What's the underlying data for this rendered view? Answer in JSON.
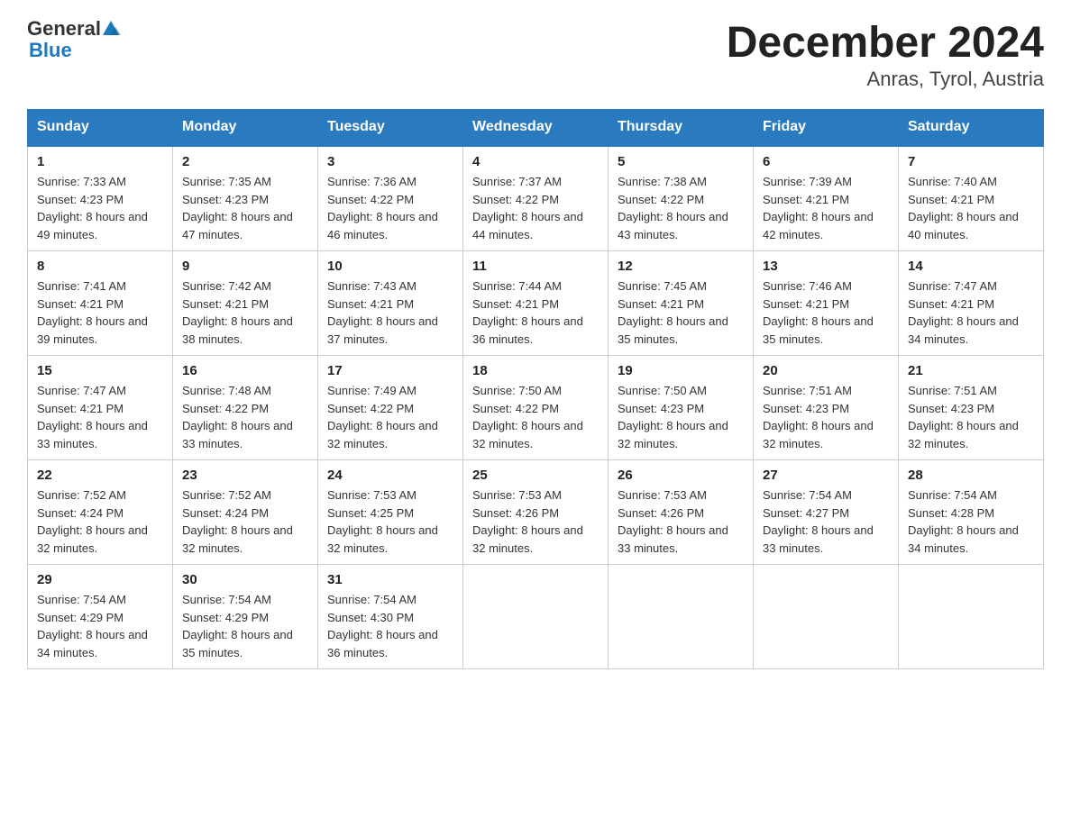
{
  "header": {
    "logo_general": "General",
    "logo_blue": "Blue",
    "title": "December 2024",
    "subtitle": "Anras, Tyrol, Austria"
  },
  "weekdays": [
    "Sunday",
    "Monday",
    "Tuesday",
    "Wednesday",
    "Thursday",
    "Friday",
    "Saturday"
  ],
  "weeks": [
    [
      {
        "day": "1",
        "sunrise": "7:33 AM",
        "sunset": "4:23 PM",
        "daylight": "8 hours and 49 minutes."
      },
      {
        "day": "2",
        "sunrise": "7:35 AM",
        "sunset": "4:23 PM",
        "daylight": "8 hours and 47 minutes."
      },
      {
        "day": "3",
        "sunrise": "7:36 AM",
        "sunset": "4:22 PM",
        "daylight": "8 hours and 46 minutes."
      },
      {
        "day": "4",
        "sunrise": "7:37 AM",
        "sunset": "4:22 PM",
        "daylight": "8 hours and 44 minutes."
      },
      {
        "day": "5",
        "sunrise": "7:38 AM",
        "sunset": "4:22 PM",
        "daylight": "8 hours and 43 minutes."
      },
      {
        "day": "6",
        "sunrise": "7:39 AM",
        "sunset": "4:21 PM",
        "daylight": "8 hours and 42 minutes."
      },
      {
        "day": "7",
        "sunrise": "7:40 AM",
        "sunset": "4:21 PM",
        "daylight": "8 hours and 40 minutes."
      }
    ],
    [
      {
        "day": "8",
        "sunrise": "7:41 AM",
        "sunset": "4:21 PM",
        "daylight": "8 hours and 39 minutes."
      },
      {
        "day": "9",
        "sunrise": "7:42 AM",
        "sunset": "4:21 PM",
        "daylight": "8 hours and 38 minutes."
      },
      {
        "day": "10",
        "sunrise": "7:43 AM",
        "sunset": "4:21 PM",
        "daylight": "8 hours and 37 minutes."
      },
      {
        "day": "11",
        "sunrise": "7:44 AM",
        "sunset": "4:21 PM",
        "daylight": "8 hours and 36 minutes."
      },
      {
        "day": "12",
        "sunrise": "7:45 AM",
        "sunset": "4:21 PM",
        "daylight": "8 hours and 35 minutes."
      },
      {
        "day": "13",
        "sunrise": "7:46 AM",
        "sunset": "4:21 PM",
        "daylight": "8 hours and 35 minutes."
      },
      {
        "day": "14",
        "sunrise": "7:47 AM",
        "sunset": "4:21 PM",
        "daylight": "8 hours and 34 minutes."
      }
    ],
    [
      {
        "day": "15",
        "sunrise": "7:47 AM",
        "sunset": "4:21 PM",
        "daylight": "8 hours and 33 minutes."
      },
      {
        "day": "16",
        "sunrise": "7:48 AM",
        "sunset": "4:22 PM",
        "daylight": "8 hours and 33 minutes."
      },
      {
        "day": "17",
        "sunrise": "7:49 AM",
        "sunset": "4:22 PM",
        "daylight": "8 hours and 32 minutes."
      },
      {
        "day": "18",
        "sunrise": "7:50 AM",
        "sunset": "4:22 PM",
        "daylight": "8 hours and 32 minutes."
      },
      {
        "day": "19",
        "sunrise": "7:50 AM",
        "sunset": "4:23 PM",
        "daylight": "8 hours and 32 minutes."
      },
      {
        "day": "20",
        "sunrise": "7:51 AM",
        "sunset": "4:23 PM",
        "daylight": "8 hours and 32 minutes."
      },
      {
        "day": "21",
        "sunrise": "7:51 AM",
        "sunset": "4:23 PM",
        "daylight": "8 hours and 32 minutes."
      }
    ],
    [
      {
        "day": "22",
        "sunrise": "7:52 AM",
        "sunset": "4:24 PM",
        "daylight": "8 hours and 32 minutes."
      },
      {
        "day": "23",
        "sunrise": "7:52 AM",
        "sunset": "4:24 PM",
        "daylight": "8 hours and 32 minutes."
      },
      {
        "day": "24",
        "sunrise": "7:53 AM",
        "sunset": "4:25 PM",
        "daylight": "8 hours and 32 minutes."
      },
      {
        "day": "25",
        "sunrise": "7:53 AM",
        "sunset": "4:26 PM",
        "daylight": "8 hours and 32 minutes."
      },
      {
        "day": "26",
        "sunrise": "7:53 AM",
        "sunset": "4:26 PM",
        "daylight": "8 hours and 33 minutes."
      },
      {
        "day": "27",
        "sunrise": "7:54 AM",
        "sunset": "4:27 PM",
        "daylight": "8 hours and 33 minutes."
      },
      {
        "day": "28",
        "sunrise": "7:54 AM",
        "sunset": "4:28 PM",
        "daylight": "8 hours and 34 minutes."
      }
    ],
    [
      {
        "day": "29",
        "sunrise": "7:54 AM",
        "sunset": "4:29 PM",
        "daylight": "8 hours and 34 minutes."
      },
      {
        "day": "30",
        "sunrise": "7:54 AM",
        "sunset": "4:29 PM",
        "daylight": "8 hours and 35 minutes."
      },
      {
        "day": "31",
        "sunrise": "7:54 AM",
        "sunset": "4:30 PM",
        "daylight": "8 hours and 36 minutes."
      },
      null,
      null,
      null,
      null
    ]
  ]
}
